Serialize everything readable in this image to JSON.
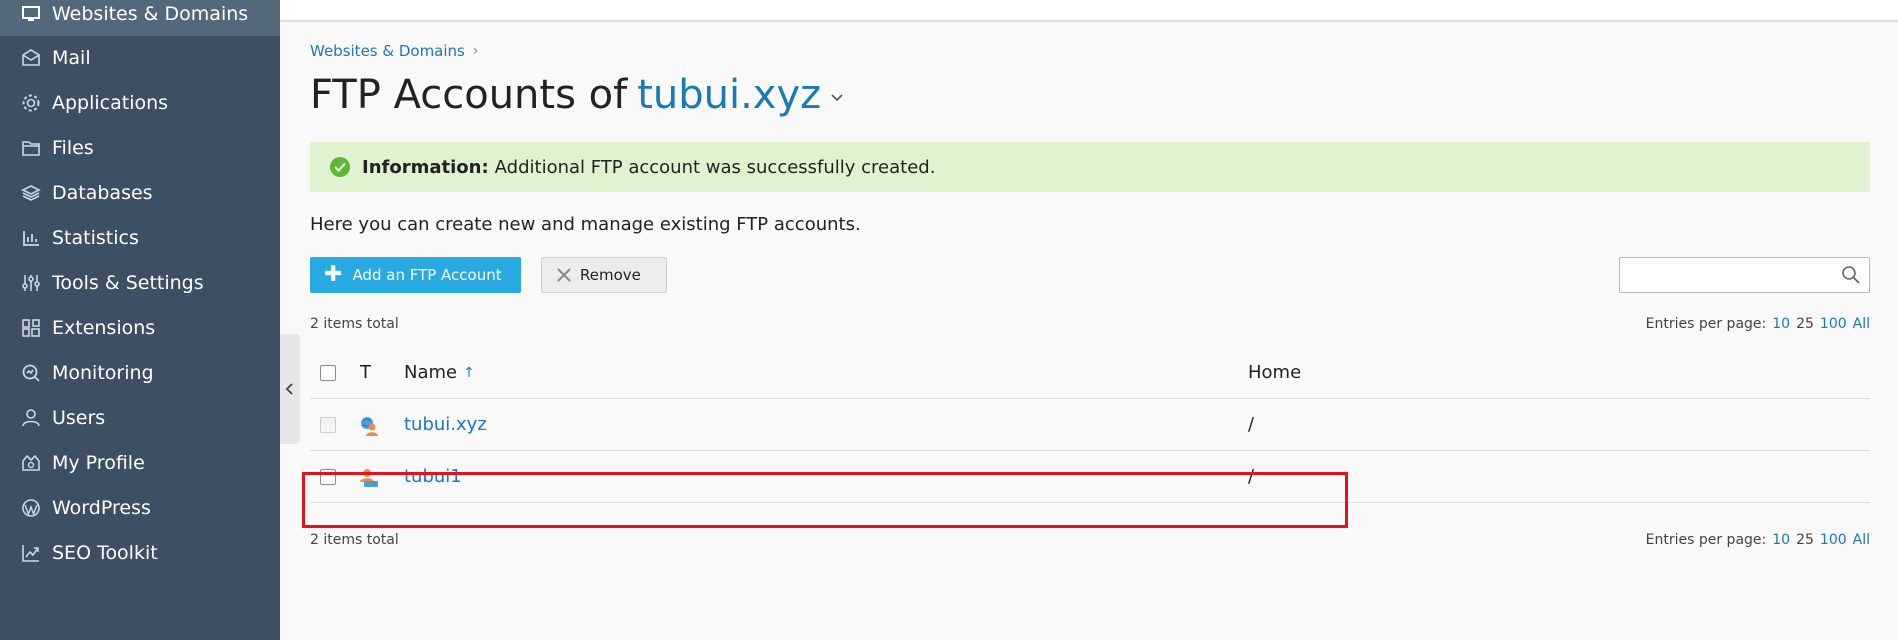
{
  "sidebar": {
    "items": [
      {
        "label": "Websites & Domains",
        "icon": "monitor-icon",
        "active": true
      },
      {
        "label": "Mail",
        "icon": "mail-icon"
      },
      {
        "label": "Applications",
        "icon": "gear-icon"
      },
      {
        "label": "Files",
        "icon": "folder-icon"
      },
      {
        "label": "Databases",
        "icon": "database-icon"
      },
      {
        "label": "Statistics",
        "icon": "bar-chart-icon"
      },
      {
        "label": "Tools & Settings",
        "icon": "sliders-icon"
      },
      {
        "label": "Extensions",
        "icon": "extensions-icon"
      },
      {
        "label": "Monitoring",
        "icon": "monitoring-icon"
      },
      {
        "label": "Users",
        "icon": "user-icon"
      },
      {
        "label": "My Profile",
        "icon": "profile-icon"
      },
      {
        "label": "WordPress",
        "icon": "wordpress-icon"
      },
      {
        "label": "SEO Toolkit",
        "icon": "seo-icon"
      }
    ]
  },
  "breadcrumb": {
    "label": "Websites & Domains"
  },
  "header": {
    "title_prefix": "FTP Accounts of",
    "domain": "tubui.xyz"
  },
  "alert": {
    "label": "Information:",
    "message": "Additional FTP account was successfully created."
  },
  "description": "Here you can create new and manage existing FTP accounts.",
  "toolbar": {
    "add_label": "Add an FTP Account",
    "remove_label": "Remove"
  },
  "search": {
    "value": "",
    "placeholder": ""
  },
  "summary": {
    "items_total": "2 items total",
    "entries_label": "Entries per page:",
    "options": [
      "10",
      "25",
      "100",
      "All"
    ]
  },
  "table": {
    "headers": {
      "type": "T",
      "name": "Name",
      "home": "Home"
    },
    "rows": [
      {
        "name": "tubui.xyz",
        "home": "/"
      },
      {
        "name": "tubui1",
        "home": "/"
      }
    ]
  },
  "colors": {
    "sidebar": "#3c4f63",
    "accent": "#1a7ab6",
    "button": "#28a9e2",
    "success_bg": "#dff3d0",
    "highlight": "#e0141c"
  }
}
